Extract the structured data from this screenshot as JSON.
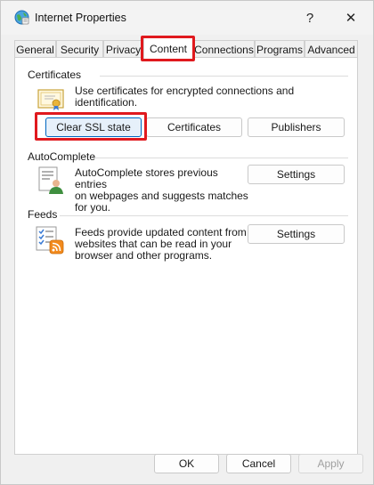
{
  "window": {
    "title": "Internet Properties",
    "help_glyph": "?",
    "close_glyph": "✕"
  },
  "tabs": [
    {
      "label": "General"
    },
    {
      "label": "Security"
    },
    {
      "label": "Privacy"
    },
    {
      "label": "Content"
    },
    {
      "label": "Connections"
    },
    {
      "label": "Programs"
    },
    {
      "label": "Advanced"
    }
  ],
  "active_tab": "Content",
  "certificates": {
    "group_label": "Certificates",
    "description": "Use certificates for encrypted connections and identification.",
    "clear_ssl_label": "Clear SSL state",
    "certificates_label": "Certificates",
    "publishers_label": "Publishers"
  },
  "autocomplete": {
    "group_label": "AutoComplete",
    "description_lines": [
      "AutoComplete stores previous entries",
      "on webpages and suggests matches",
      "for you."
    ],
    "settings_label": "Settings"
  },
  "feeds": {
    "group_label": "Feeds",
    "description_lines": [
      "Feeds provide updated content from",
      "websites that can be read in your",
      "browser and other programs."
    ],
    "settings_label": "Settings"
  },
  "footer": {
    "ok_label": "OK",
    "cancel_label": "Cancel",
    "apply_label": "Apply"
  },
  "colors": {
    "highlight": "#e0191e",
    "focus_border": "#0067c0"
  }
}
